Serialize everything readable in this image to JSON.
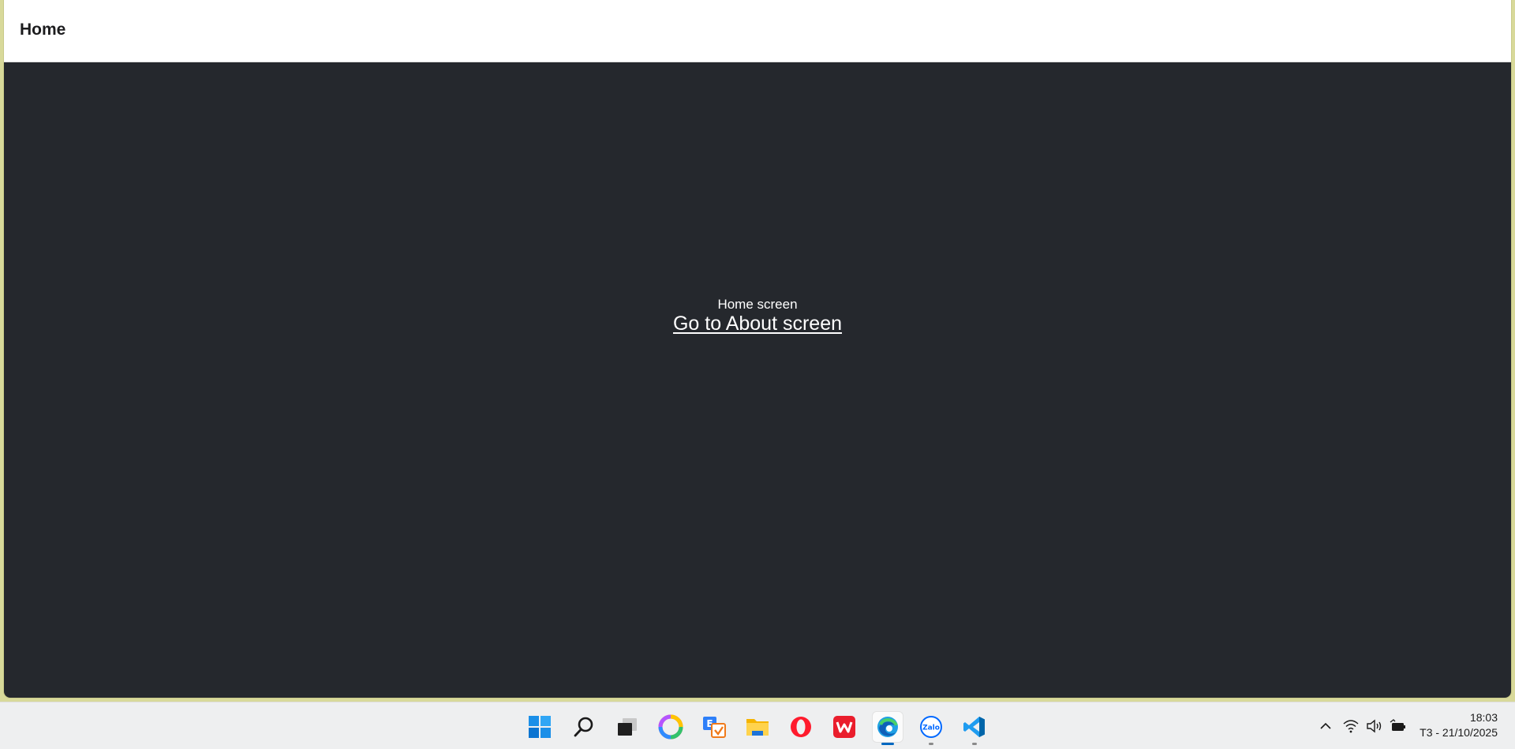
{
  "header": {
    "title": "Home"
  },
  "main": {
    "text": "Home screen",
    "link_label": "Go to About screen"
  },
  "taskbar": {
    "apps": [
      {
        "icon": "windows-start-icon"
      },
      {
        "icon": "search-icon"
      },
      {
        "icon": "task-view-icon"
      },
      {
        "icon": "photos-app-icon"
      },
      {
        "icon": "dictionary-app-icon"
      },
      {
        "icon": "file-explorer-icon"
      },
      {
        "icon": "opera-browser-icon"
      },
      {
        "icon": "wps-office-icon"
      },
      {
        "icon": "edge-browser-icon"
      },
      {
        "icon": "zalo-app-icon",
        "label": "Zalo"
      },
      {
        "icon": "vscode-icon"
      }
    ],
    "tray": {
      "icons": [
        "chevron-up-icon",
        "wifi-icon",
        "volume-icon",
        "battery-icon"
      ],
      "time": "18:03",
      "date": "T3 - 21/10/2025"
    }
  },
  "colors": {
    "header_bg": "#ffffff",
    "content_bg": "#25282d",
    "taskbar_bg": "#eeeff0",
    "accent": "#0067c0",
    "desktop_bg": "#d8d99a"
  }
}
